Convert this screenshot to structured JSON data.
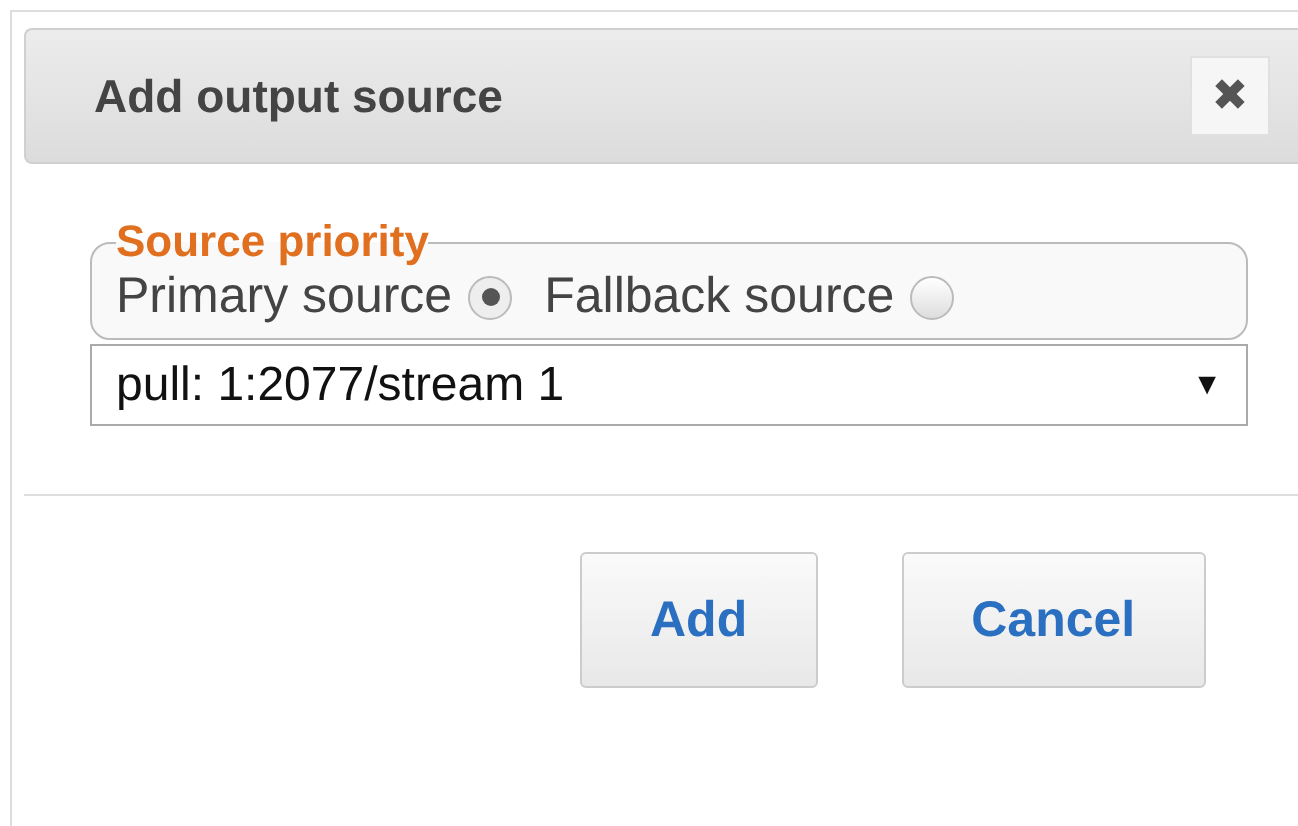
{
  "dialog": {
    "title": "Add output source",
    "close_icon": "✖"
  },
  "source_priority": {
    "legend": "Source priority",
    "options": [
      {
        "label": "Primary source",
        "selected": true
      },
      {
        "label": "Fallback source",
        "selected": false
      }
    ]
  },
  "source_select": {
    "value": "pull: 1:2077/stream 1",
    "arrow": "▼"
  },
  "buttons": [
    {
      "label": "Add"
    },
    {
      "label": "Cancel"
    }
  ]
}
